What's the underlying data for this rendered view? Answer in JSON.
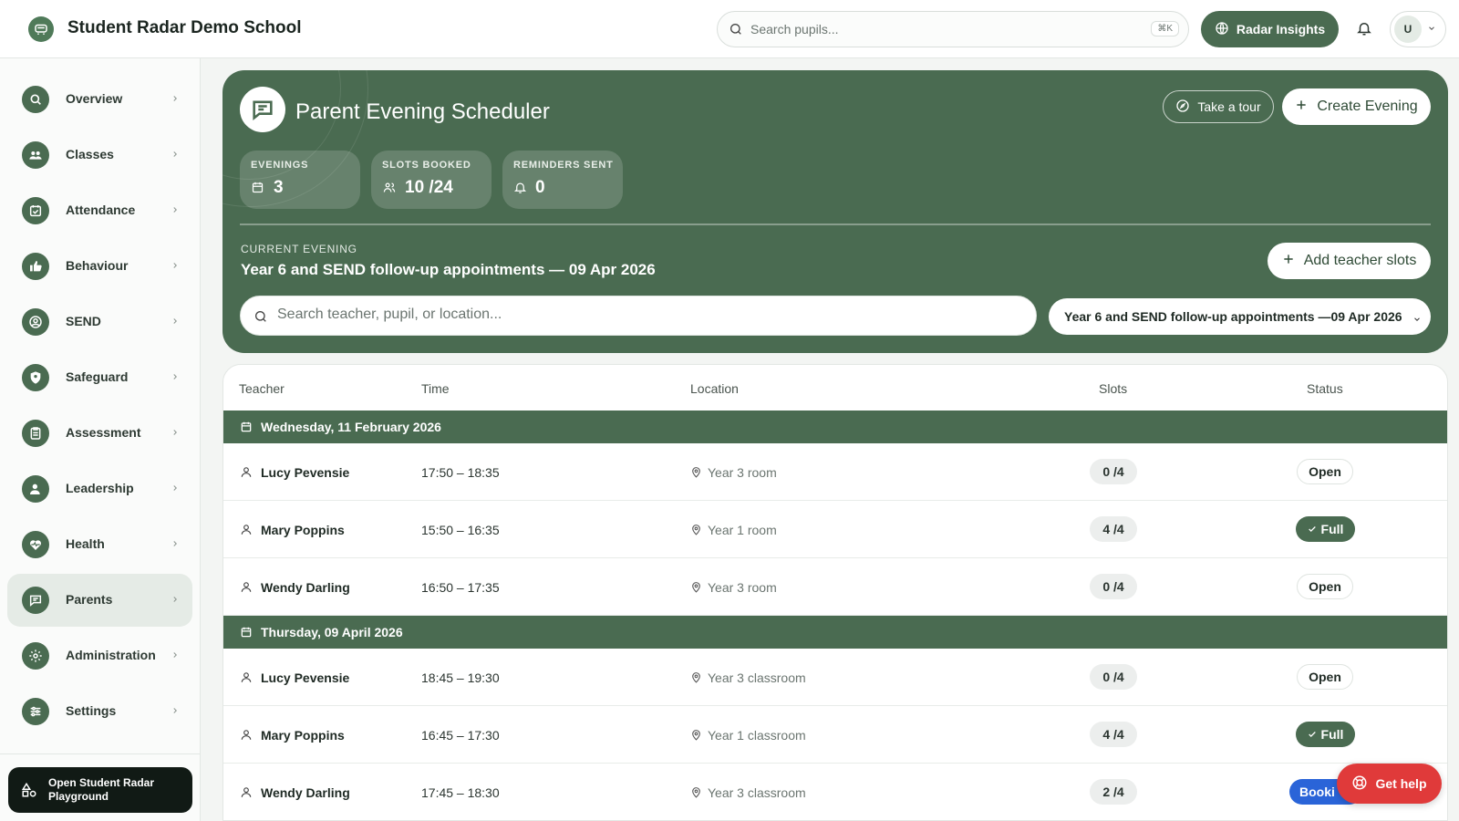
{
  "header": {
    "school_name": "Student Radar Demo School",
    "search_placeholder": "Search pupils...",
    "search_shortcut": "⌘K",
    "insights_label": "Radar Insights",
    "user_initial": "U"
  },
  "sidebar": {
    "items": [
      {
        "label": "Overview",
        "icon": "search-icon"
      },
      {
        "label": "Classes",
        "icon": "users-icon"
      },
      {
        "label": "Attendance",
        "icon": "calendar-check-icon"
      },
      {
        "label": "Behaviour",
        "icon": "thumbs-up-icon"
      },
      {
        "label": "SEND",
        "icon": "person-circle-icon"
      },
      {
        "label": "Safeguard",
        "icon": "shield-icon"
      },
      {
        "label": "Assessment",
        "icon": "clipboard-icon"
      },
      {
        "label": "Leadership",
        "icon": "user-star-icon"
      },
      {
        "label": "Health",
        "icon": "heart-pulse-icon"
      },
      {
        "label": "Parents",
        "icon": "chat-icon",
        "active": true
      },
      {
        "label": "Administration",
        "icon": "gear-icon"
      },
      {
        "label": "Settings",
        "icon": "sliders-icon"
      }
    ],
    "playground_label": "Open Student Radar Playground"
  },
  "hero": {
    "title": "Parent Evening Scheduler",
    "tour_label": "Take a tour",
    "create_label": "Create Evening",
    "stats": [
      {
        "label": "EVENINGS",
        "value": "3",
        "icon": "calendar-icon"
      },
      {
        "label": "SLOTS BOOKED",
        "value": "10 /24",
        "icon": "users-icon"
      },
      {
        "label": "REMINDERS SENT",
        "value": "0",
        "icon": "bell-icon"
      }
    ],
    "current_label": "CURRENT EVENING",
    "current_title": "Year 6 and SEND follow-up appointments — 09 Apr 2026",
    "add_slots_label": "Add teacher slots",
    "search_placeholder": "Search teacher, pupil, or location...",
    "selected_evening": "Year 6 and SEND follow-up appointments —09 Apr 2026"
  },
  "table": {
    "columns": [
      "Teacher",
      "Time",
      "Location",
      "Slots",
      "Status"
    ],
    "groups": [
      {
        "date": "Wednesday, 11 February 2026",
        "rows": [
          {
            "teacher": "Lucy Pevensie",
            "time": "17:50 – 18:35",
            "location": "Year 3 room",
            "slots": "0 /4",
            "status": "Open"
          },
          {
            "teacher": "Mary Poppins",
            "time": "15:50 – 16:35",
            "location": "Year 1 room",
            "slots": "4 /4",
            "status": "Full"
          },
          {
            "teacher": "Wendy Darling",
            "time": "16:50 – 17:35",
            "location": "Year 3 room",
            "slots": "0 /4",
            "status": "Open"
          }
        ]
      },
      {
        "date": "Thursday, 09 April 2026",
        "rows": [
          {
            "teacher": "Lucy Pevensie",
            "time": "18:45 – 19:30",
            "location": "Year 3 classroom",
            "slots": "0 /4",
            "status": "Open"
          },
          {
            "teacher": "Mary Poppins",
            "time": "16:45 – 17:30",
            "location": "Year 1 classroom",
            "slots": "4 /4",
            "status": "Full"
          },
          {
            "teacher": "Wendy Darling",
            "time": "17:45 – 18:30",
            "location": "Year 3 classroom",
            "slots": "2 /4",
            "status": "Booki"
          }
        ]
      }
    ]
  },
  "help": {
    "label": "Get help"
  },
  "colors": {
    "brand": "#4a6b51",
    "help": "#e03a3a",
    "booking": "#2a64d8"
  }
}
